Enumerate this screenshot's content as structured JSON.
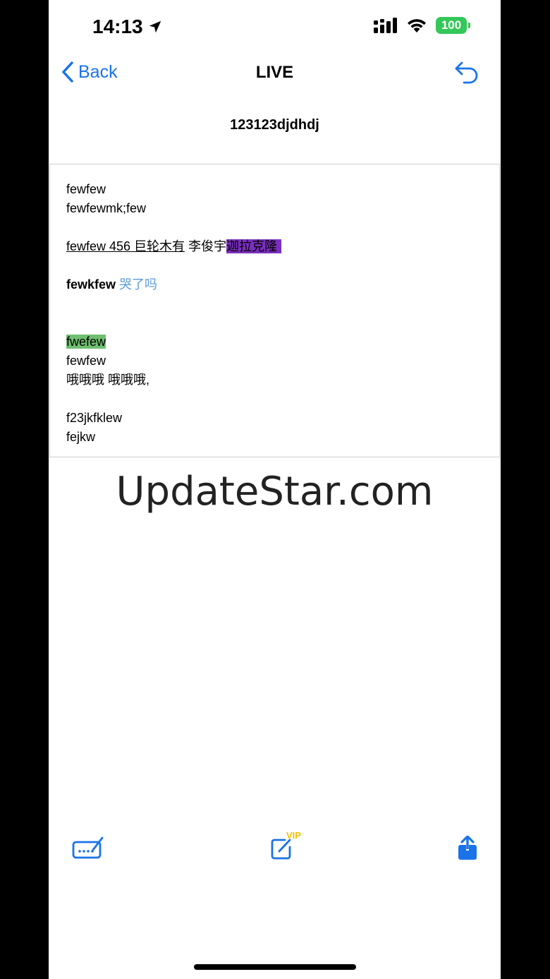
{
  "status_bar": {
    "time": "14:13",
    "battery": "100"
  },
  "nav": {
    "back_label": "Back",
    "title": "LIVE"
  },
  "note": {
    "title": "123123djdhdj",
    "lines": {
      "l1": " fewfew",
      "l2": "fewfewmk;few",
      "l3_underlined": "fewfew 456 巨轮木有",
      "l3_plain": " 李俊宇",
      "l3_purple": "迦拉克隆",
      "l4_bold": "fewkfew",
      "l4_blue": " 哭了吗",
      "l5_green": "fwefew",
      "l6": "fewfew",
      "l7": "哦哦哦 哦哦哦,",
      "l8": "f23jkfklew",
      "l9": "fejkw"
    }
  },
  "watermark": "UpdateStar.com",
  "toolbar": {
    "vip_label": "VIP"
  },
  "colors": {
    "accent": "#1a73e8",
    "highlight_purple": "#7b2fbe",
    "highlight_green": "#6fbf6f",
    "text_blue": "#5b9bd5",
    "vip_yellow": "#f2c200",
    "battery_green": "#34c759"
  }
}
